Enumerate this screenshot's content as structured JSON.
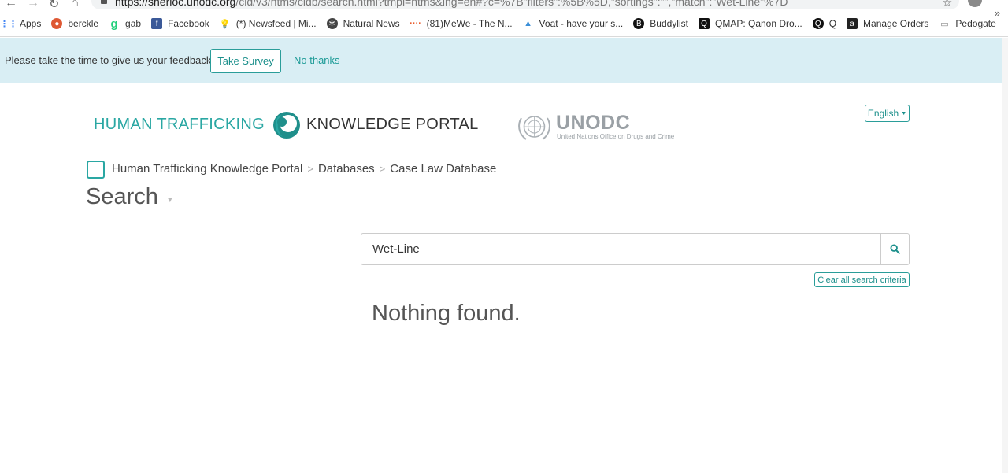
{
  "browser": {
    "url_host": "https://sherloc.unodc.org",
    "url_path": "/cld/v3/htms/cldb/search.html?tmpl=htms&lng=en#?c=%7B\"filters\":%5B%5D,\"sortings\":\"\",\"match\":\"Wet-Line\"%7D"
  },
  "bookmarks": [
    {
      "label": "Apps",
      "icon": "apps-grid-icon",
      "color": "#4285f4"
    },
    {
      "label": "berckle",
      "icon": "duckduckgo-icon",
      "color": "#de5833"
    },
    {
      "label": "gab",
      "icon": "gab-icon",
      "color": "#21cf7a"
    },
    {
      "label": "Facebook",
      "icon": "facebook-icon",
      "color": "#3b5998"
    },
    {
      "label": "(*) Newsfeed | Mi...",
      "icon": "lightbulb-icon",
      "color": "#f4c20d"
    },
    {
      "label": "Natural News",
      "icon": "naturalnews-icon",
      "color": "#444444"
    },
    {
      "label": "(81)MeWe - The N...",
      "icon": "mewe-icon",
      "color": "#e85b2b"
    },
    {
      "label": "Voat - have your s...",
      "icon": "voat-icon",
      "color": "#3b8fd8"
    },
    {
      "label": "Buddylist",
      "icon": "buddylist-icon",
      "color": "#111111"
    },
    {
      "label": "QMAP: Qanon Dro...",
      "icon": "qmap-icon",
      "color": "#111111"
    },
    {
      "label": "Q",
      "icon": "q-icon",
      "color": "#111111"
    },
    {
      "label": "Manage Orders",
      "icon": "amazon-icon",
      "color": "#222222"
    },
    {
      "label": "Pedogate",
      "icon": "folder-icon",
      "color": "#888888"
    }
  ],
  "feedback": {
    "message": "Please take the time to give us your feedback.",
    "take_survey": "Take Survey",
    "no_thanks": "No thanks"
  },
  "header": {
    "logo_part1": "HUMAN TRAFFICKING",
    "logo_part2": "KNOWLEDGE PORTAL",
    "unodc_name": "UNODC",
    "unodc_sub": "United Nations Office on Drugs and Crime",
    "language": "English"
  },
  "breadcrumb": [
    "Human Trafficking Knowledge Portal",
    "Databases",
    "Case Law Database"
  ],
  "page_title": "Search",
  "search": {
    "value": "Wet-Line",
    "clear_label": "Clear all search criteria"
  },
  "results": {
    "message": "Nothing found."
  },
  "colors": {
    "accent": "#2aa7a3",
    "banner_bg": "#d9eef4"
  }
}
